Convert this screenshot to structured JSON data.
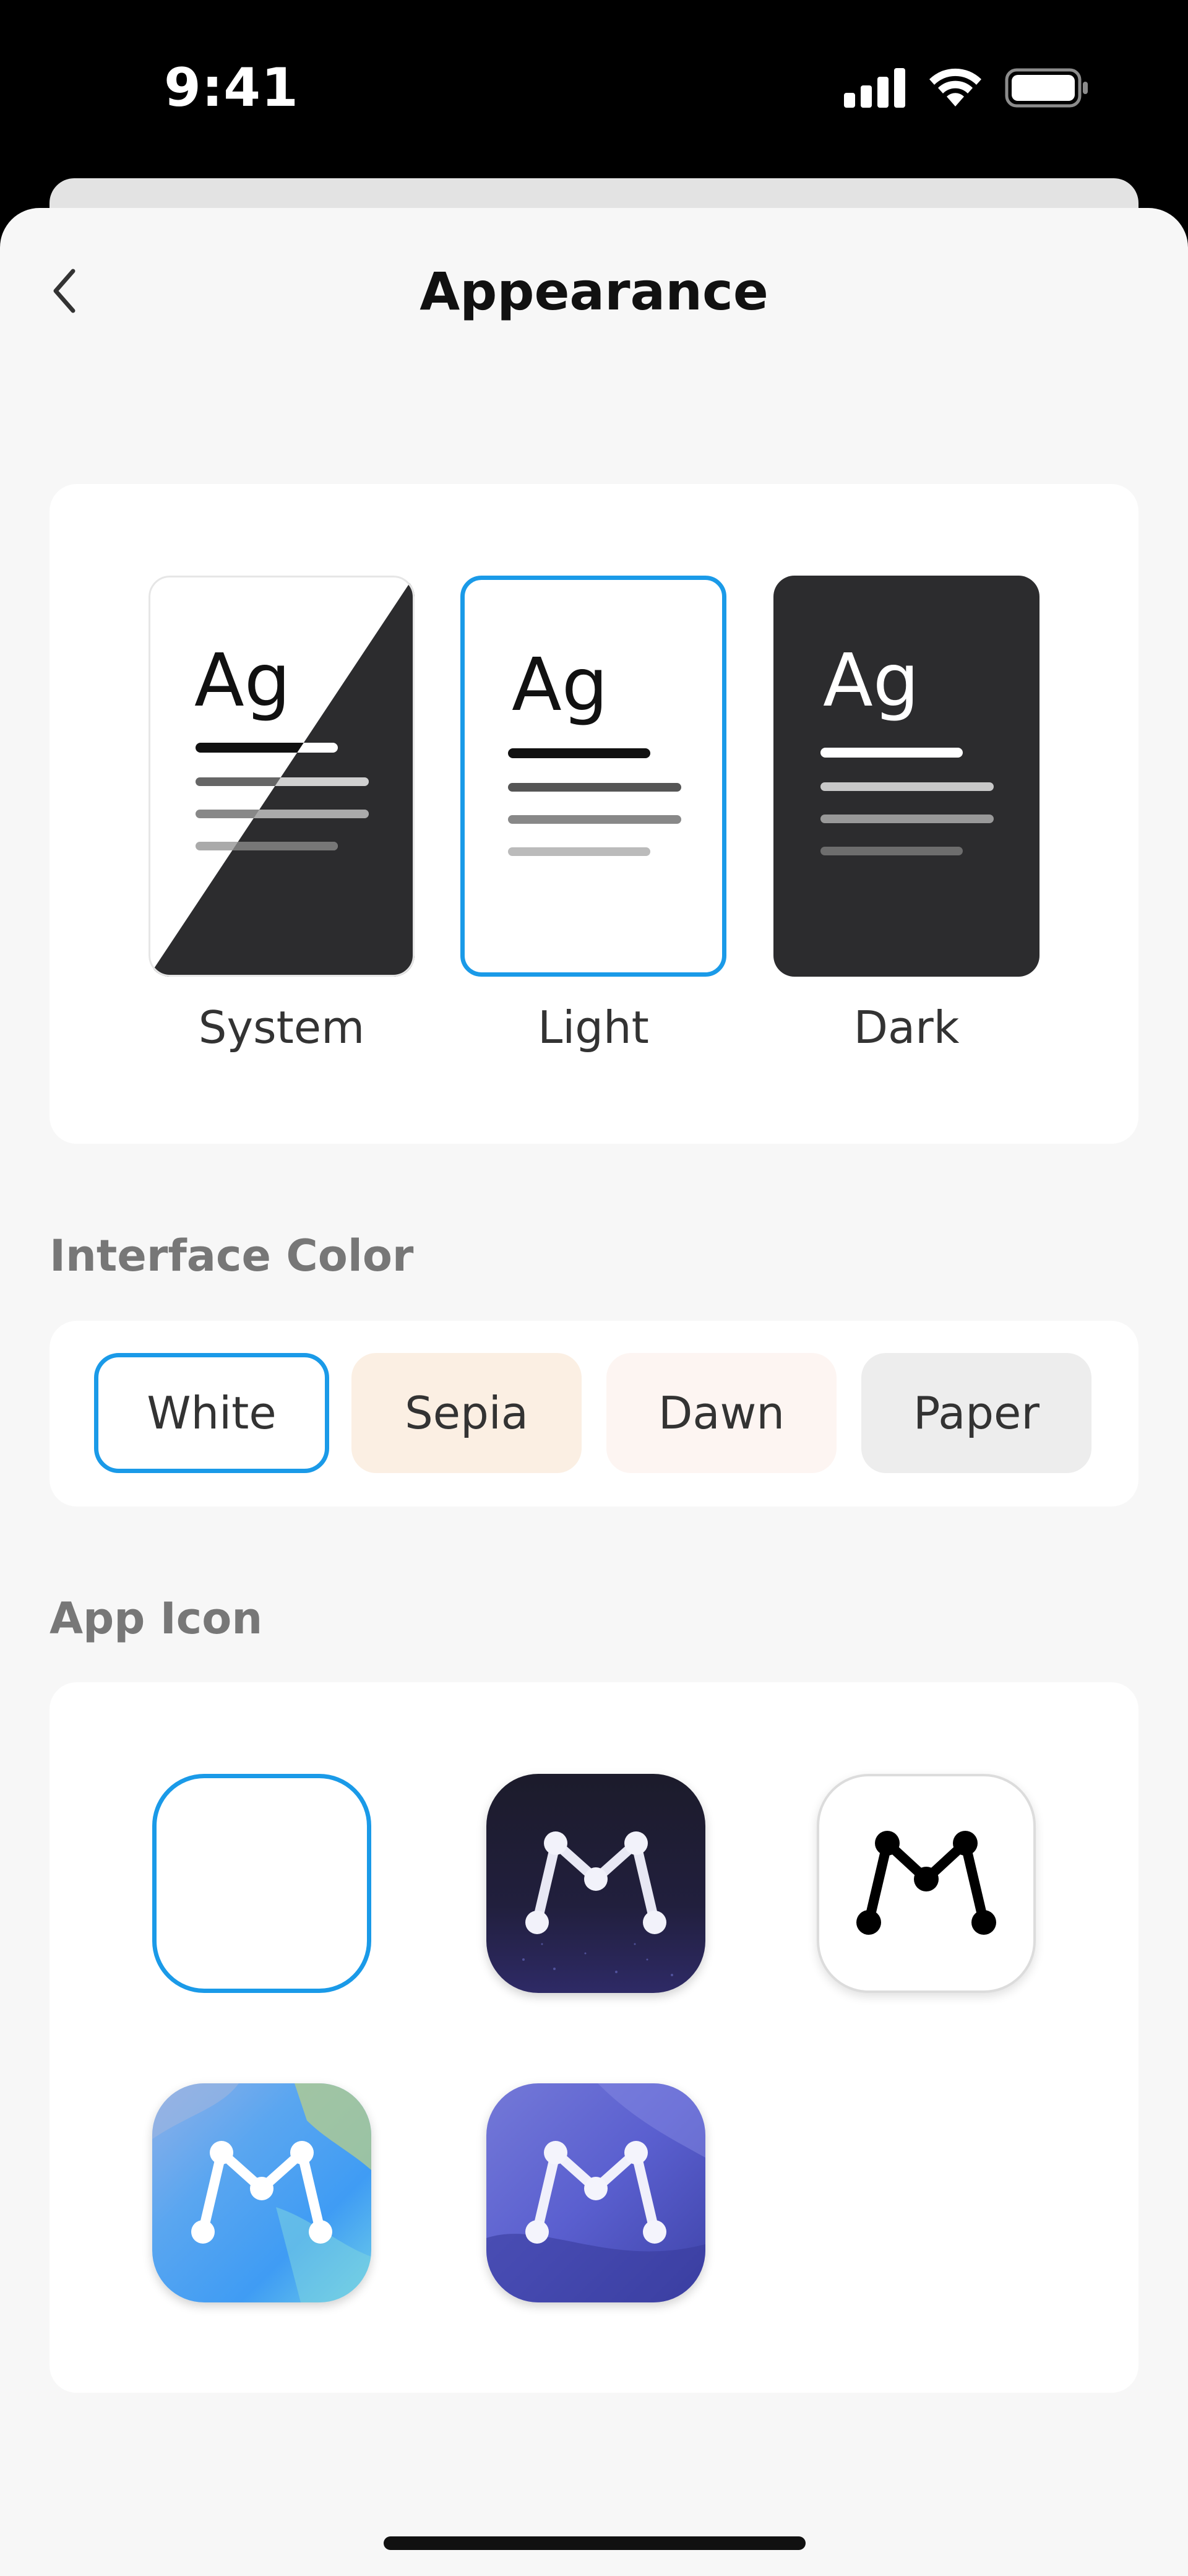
{
  "status_bar": {
    "time": "9:41",
    "icons": [
      "cellular-signal-icon",
      "wifi-icon",
      "battery-icon"
    ]
  },
  "nav": {
    "back_icon": "chevron-left-icon",
    "title": "Appearance"
  },
  "theme": {
    "options": [
      {
        "label": "System",
        "sample": "Ag",
        "selected": false
      },
      {
        "label": "Light",
        "sample": "Ag",
        "selected": true
      },
      {
        "label": "Dark",
        "sample": "Ag",
        "selected": false
      }
    ]
  },
  "interface_color": {
    "heading": "Interface Color",
    "options": [
      {
        "label": "White",
        "selected": true,
        "color": "#ffffff"
      },
      {
        "label": "Sepia",
        "selected": false,
        "color": "#fbefe3"
      },
      {
        "label": "Dawn",
        "selected": false,
        "color": "#fdf5f2"
      },
      {
        "label": "Paper",
        "selected": false,
        "color": "#ededed"
      }
    ]
  },
  "app_icon": {
    "heading": "App Icon",
    "options": [
      {
        "name": "default-blank-icon",
        "selected": true
      },
      {
        "name": "night-sky-m-icon",
        "selected": false
      },
      {
        "name": "white-black-m-icon",
        "selected": false
      },
      {
        "name": "watercolor-m-icon",
        "selected": false
      },
      {
        "name": "indigo-m-icon",
        "selected": false
      }
    ]
  },
  "colors": {
    "accent": "#1a9ae8",
    "dark_tile": "#2c2c2e",
    "sheet_bg": "#f7f7f7"
  }
}
